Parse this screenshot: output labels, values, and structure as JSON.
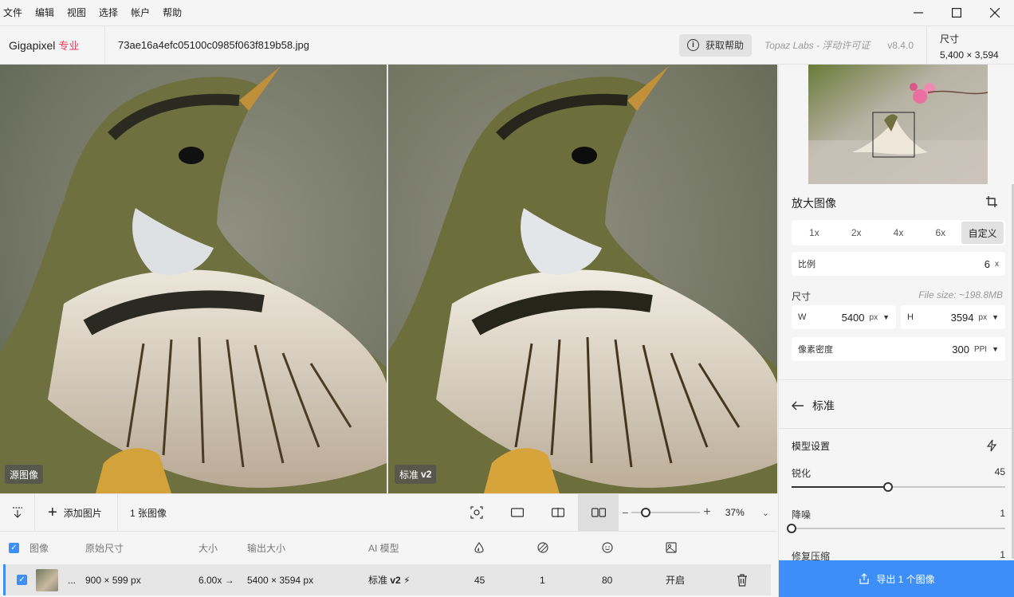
{
  "menu": [
    "文件",
    "编辑",
    "视图",
    "选择",
    "帐户",
    "帮助"
  ],
  "header": {
    "app_name": "Gigapixel",
    "edition": "专业",
    "filename": "73ae16a4efc05100c0985f063f819b58.jpg",
    "help_label": "获取帮助",
    "license": "Topaz Labs - 浮动许可证",
    "version": "v8.4.0",
    "size_label": "尺寸",
    "size_value": "5,400 × 3,594"
  },
  "viewer": {
    "left_label": "源图像",
    "right_label": "标准",
    "right_label_version": "v2"
  },
  "panel": {
    "upscale_title": "放大图像",
    "scale_options": [
      "1x",
      "2x",
      "4x",
      "6x",
      "自定义"
    ],
    "active_scale": "自定义",
    "ratio_label": "比例",
    "ratio_value": "6",
    "ratio_unit": "x",
    "dimensions_label": "尺寸",
    "file_size": "File size: ~198.8MB",
    "width_label": "W",
    "width_value": "5400",
    "width_unit": "px",
    "height_label": "H",
    "height_value": "3594",
    "height_unit": "px",
    "density_label": "像素密度",
    "density_value": "300",
    "density_unit": "PPI",
    "model_name": "标准",
    "model_settings_title": "模型设置",
    "sliders": [
      {
        "label": "锐化",
        "value": "45",
        "fraction": 0.45
      },
      {
        "label": "降噪",
        "value": "1",
        "fraction": 0.0
      },
      {
        "label": "修复压缩",
        "value": "1",
        "fraction": 0.0
      }
    ],
    "export_label": "导出 1 个图像"
  },
  "toolbar": {
    "add_image": "添加图片",
    "image_count": "1 张图像",
    "zoom": "37%",
    "zoom_fraction": 0.2
  },
  "table": {
    "headers": [
      "图像",
      "原始尺寸",
      "大小",
      "输出大小",
      "AI 模型"
    ],
    "row": {
      "ellipsis": "...",
      "original_size": "900 × 599 px",
      "scale": "6.00x →",
      "output_size": "5400 × 3594 px",
      "model": "标准",
      "model_version": "v2",
      "sharpen": "45",
      "denoise": "1",
      "face": "80",
      "face_recovery": "开启"
    }
  }
}
